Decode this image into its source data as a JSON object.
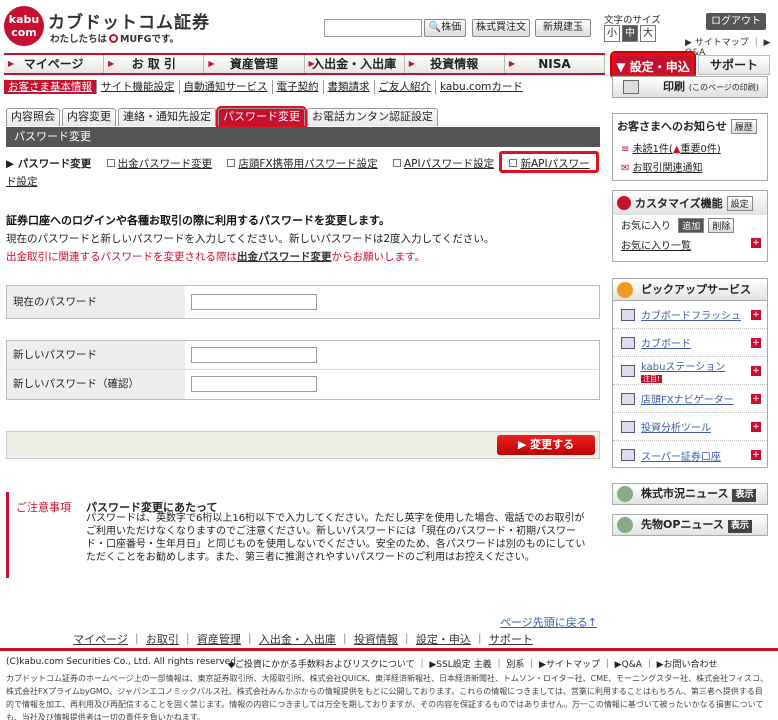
{
  "header": {
    "logo_mark": "kabu\ncom",
    "logo_name": "カブドットコム証券",
    "logo_sub": "わたしたちは",
    "logo_sub_brand": "MUFGです。",
    "search_button": "株価",
    "buttons": [
      "株式買注文",
      "新規建玉"
    ],
    "font_size_label": "文字のサイズ",
    "font_sizes": [
      "小",
      "中",
      "大"
    ],
    "logout": "ログアウト",
    "top_links": "▶ サイトマップ ｜ ▶ Q&A"
  },
  "main_nav": [
    "マイページ",
    "お 取 引",
    "資産管理",
    "入出金・入出庫",
    "投資情報",
    "NISA"
  ],
  "nav_settings": "▼ 設定・申込",
  "nav_support": "サポート",
  "sub_nav": [
    "お客さま基本情報",
    "サイト機能設定",
    "自動通知サービス",
    "電子契約",
    "書類請求",
    "ご友人紹介",
    "kabu.comカード"
  ],
  "print": {
    "label": "印刷",
    "sub": "(このページの印刷)"
  },
  "tabs": [
    "内容照会",
    "内容変更",
    "連絡・通知先設定",
    "パスワード変更",
    "お電話カンタン認証設定"
  ],
  "page_title": "パスワード変更",
  "sub_links": {
    "current": "パスワード変更",
    "items": [
      "出金パスワード変更",
      "店頭FX携帯用パスワード設定",
      "APIパスワード設定",
      "新APIパスワード設定"
    ]
  },
  "intro": {
    "line1": "証券口座へのログインや各種お取引の際に利用するパスワードを変更します。",
    "line2": "現在のパスワードと新しいパスワードを入力してください。新しいパスワードは2度入力してください。",
    "line3_pre": "出金取引に関連するパスワードを変更される際は",
    "line3_link": "出金パスワード変更",
    "line3_post": "からお願いします。"
  },
  "form": {
    "current_label": "現在のパスワード",
    "new_label": "新しいパスワード",
    "confirm_label": "新しいパスワード（確認）",
    "submit": "▶ 変更する"
  },
  "notes": {
    "label": "ご注意事項",
    "title": "パスワード変更にあたって",
    "body": "パスワードは、英数字で6桁以上16桁以下で入力してください。ただし英字を使用した場合、電話でのお取引がご利用いただけなくなりますのでご注意ください。新しいパスワードには「現在のパスワード・初期パスワード・口座番号・生年月日」と同じものを使用しないでください。安全のため、各パスワードは別のものにしていただくことをお勧めします。また、第三者に推測されやすいパスワードのご利用はお控えください。"
  },
  "page_top": "ページ先頭に戻る↑",
  "footer_nav": [
    "マイページ",
    "お取引",
    "資産管理",
    "入出金・入出庫",
    "投資情報",
    "設定・申込",
    "サポート"
  ],
  "copyright": "(C)kabu.com Securities Co., Ltd. All rights reserved.",
  "footer_links": "◆ご投資にかかる手数料およびリスクについて ｜ ▶SSL設定 主義 ｜ 別系 ｜ ▶サイトマップ ｜ ▶Q&A ｜ ▶お問い合わせ",
  "disclaimer": "カブドットコム証券のホームページ上の一部情報は、東京証券取引所、大阪取引所、株式会社QUICK、東洋経済新報社、日本経済新聞社、トムソン・ロイター社、CME、モーニングスター社、株式会社フィスコ、株式会社FXプライムbyGMO、ジャパンエコノミックパルス社、株式会社みんかぶからの情報提供をもとに公開しております。これらの情報につきましては、営業に利用することはもちろん、第三者へ提供する目的で情報を加工、再利用及び再配信することを固く禁じます。情報の内容につきましては万全を期しておりますが、その内容を保証するものではありません。万一この情報に基づいて被ったいかなる損害についても、当社及び情報提供者は一切の責任を負いかねます。",
  "sidebar": {
    "notice_title": "お客さまへのお知らせ",
    "notice_btn": "履歴",
    "unread": "未読1件(",
    "important": "重要0件)",
    "trade_notice": "お取引関連通知",
    "custom_title": "カスタマイズ機能",
    "custom_btn": "設定",
    "fav_label": "お気に入り",
    "fav_add": "追加",
    "fav_del": "削除",
    "fav_list": "お気に入り一覧",
    "pickup_title": "ピックアップサービス",
    "pickup_items": [
      "カブボードフラッシュ",
      "カブボード",
      "kabuステーション",
      "店頭FXナビゲーター",
      "投資分析ツール",
      "スーパー証券口座"
    ],
    "kabu_badge": "注目!",
    "market_news": "株式市況ニュース",
    "op_news": "先物OPニュース",
    "show": "表示"
  }
}
